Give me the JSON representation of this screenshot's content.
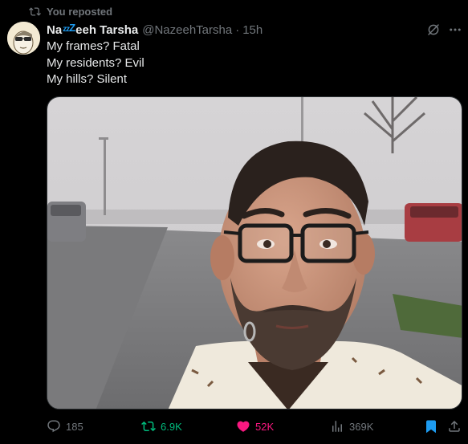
{
  "repost": {
    "text": "You reposted",
    "icon": "repost-icon"
  },
  "author": {
    "name_prefix": "Na",
    "name_sleep_small": "zz",
    "name_sleep_big": "Z",
    "name_suffix": "eeh Tarsha",
    "handle": "@NazeehTarsha",
    "separator": "·",
    "time": "15h"
  },
  "tweet": {
    "lines": [
      "My frames? Fatal",
      "My residents? Evil",
      "My hills? Silent"
    ]
  },
  "actions": {
    "replies": "185",
    "reposts": "6.9K",
    "likes": "52K",
    "views": "369K"
  },
  "colors": {
    "background": "#000000",
    "text": "#e7e9ea",
    "muted": "#71767b",
    "repost_green": "#00ba7c",
    "like_pink": "#f91880",
    "bookmark_blue": "#1d9bf0"
  }
}
